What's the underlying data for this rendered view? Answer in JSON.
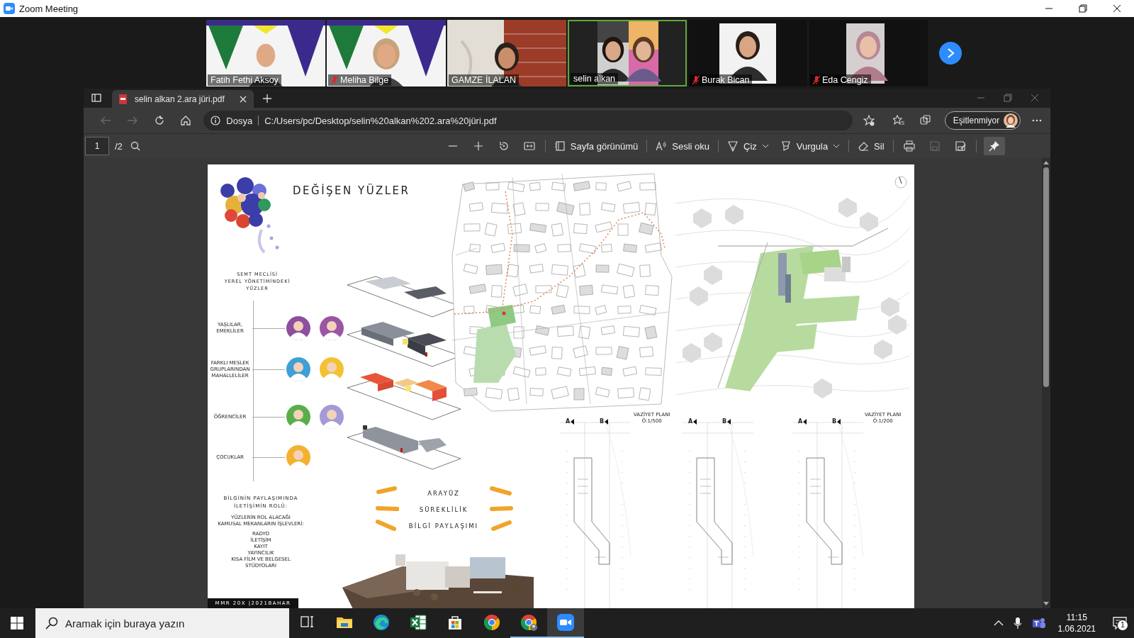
{
  "window": {
    "title": "Zoom Meeting"
  },
  "participants": [
    {
      "name": "Fatih Fethi Aksoy",
      "muted": false,
      "selected": false
    },
    {
      "name": "Meliha Bilge",
      "muted": true,
      "selected": false
    },
    {
      "name": "GAMZE İLALAN",
      "muted": false,
      "selected": false
    },
    {
      "name": "selin alkan",
      "muted": false,
      "selected": true
    },
    {
      "name": "Burak Bican",
      "muted": true,
      "selected": false
    },
    {
      "name": "Eda Cengiz",
      "muted": true,
      "selected": false
    }
  ],
  "browser": {
    "tab": {
      "title": "selin alkan 2.ara jüri.pdf"
    },
    "address": {
      "scheme": "Dosya",
      "url": "C:/Users/pc/Desktop/selin%20alkan%202.ara%20jüri.pdf"
    },
    "profile_button": "Eşitlenmiyor"
  },
  "pdf_toolbar": {
    "page": "1",
    "page_count": "/2",
    "pinned": true,
    "tools": [
      {
        "kind": "page_view",
        "label": "Sayfa görünümü",
        "dropdown": false
      },
      {
        "kind": "read_aloud",
        "label": "Sesli oku",
        "dropdown": false
      },
      {
        "kind": "draw",
        "label": "Çiz",
        "dropdown": true
      },
      {
        "kind": "highlight",
        "label": "Vurgula",
        "dropdown": true
      },
      {
        "kind": "erase",
        "label": "Sil",
        "dropdown": false
      }
    ]
  },
  "poster": {
    "title": "DEĞİŞEN YÜZLER",
    "group_heading": [
      "SEMT MECLİSİ",
      "YEREL YÖNETİMİNDEKİ",
      "YÜZLER"
    ],
    "groups": [
      {
        "label": [
          "YAŞLILAR,",
          "EMEKLİLER"
        ],
        "avatars": [
          {
            "color": "#8e4f9e"
          },
          {
            "color": "#9b55a3"
          }
        ]
      },
      {
        "label": [
          "FARKLI MESLEK",
          "GRUPLARINDAN",
          "MAHALLELİLER"
        ],
        "avatars": [
          {
            "color": "#3f9fd6"
          },
          {
            "color": "#f3c233"
          }
        ]
      },
      {
        "label": [
          "ÖĞRENCİLER"
        ],
        "avatars": [
          {
            "color": "#5aae4a"
          },
          {
            "color": "#a39ad6"
          }
        ]
      },
      {
        "label": [
          "ÇOCUKLAR"
        ],
        "avatars": [
          {
            "color": "#f2b22e"
          }
        ]
      }
    ],
    "info": {
      "heading": [
        "BİLGİNİN PAYLAŞIMINDA",
        "İLETİŞİMİN ROLÜ:"
      ],
      "subheading": [
        "YÜZLERİN ROL ALACAĞI",
        "KAMUSAL MEKANLARIN İŞLEVLERİ:"
      ],
      "items": [
        "RADYO",
        "İLETİŞİM",
        "KAYIT",
        "YAYINCILIK",
        "KISA FİLM VE BELGESEL",
        "STÜDYOLARI"
      ]
    },
    "themes": [
      "ARAYÜZ",
      "SÜREKLİLİK",
      "BİLGİ PAYLAŞIMI"
    ],
    "sections": [
      {
        "markers": [
          "A",
          "B"
        ],
        "caption": [
          "VAZİYET PLANI",
          "Ö:1/500"
        ]
      },
      {
        "markers": [
          "A",
          "B"
        ]
      },
      {
        "markers": [
          "A",
          "B"
        ],
        "caption": [
          "VAZİYET PLANI",
          "Ö:1/200"
        ]
      }
    ],
    "footer": "MMR 20X |2021BAHAR"
  },
  "taskbar": {
    "search_placeholder": "Aramak için buraya yazın",
    "apps": [
      {
        "kind": "task_view",
        "running": false,
        "selected": false
      },
      {
        "kind": "explorer",
        "running": false,
        "selected": false
      },
      {
        "kind": "edge",
        "running": false,
        "selected": false
      },
      {
        "kind": "excel",
        "running": false,
        "selected": false
      },
      {
        "kind": "store",
        "running": false,
        "selected": false
      },
      {
        "kind": "chrome",
        "running": false,
        "selected": false
      },
      {
        "kind": "chrome_profile",
        "running": true,
        "selected": false
      },
      {
        "kind": "zoom",
        "running": true,
        "selected": true
      }
    ],
    "time": "11:15",
    "date": "1.06.2021",
    "notifications": "1"
  }
}
